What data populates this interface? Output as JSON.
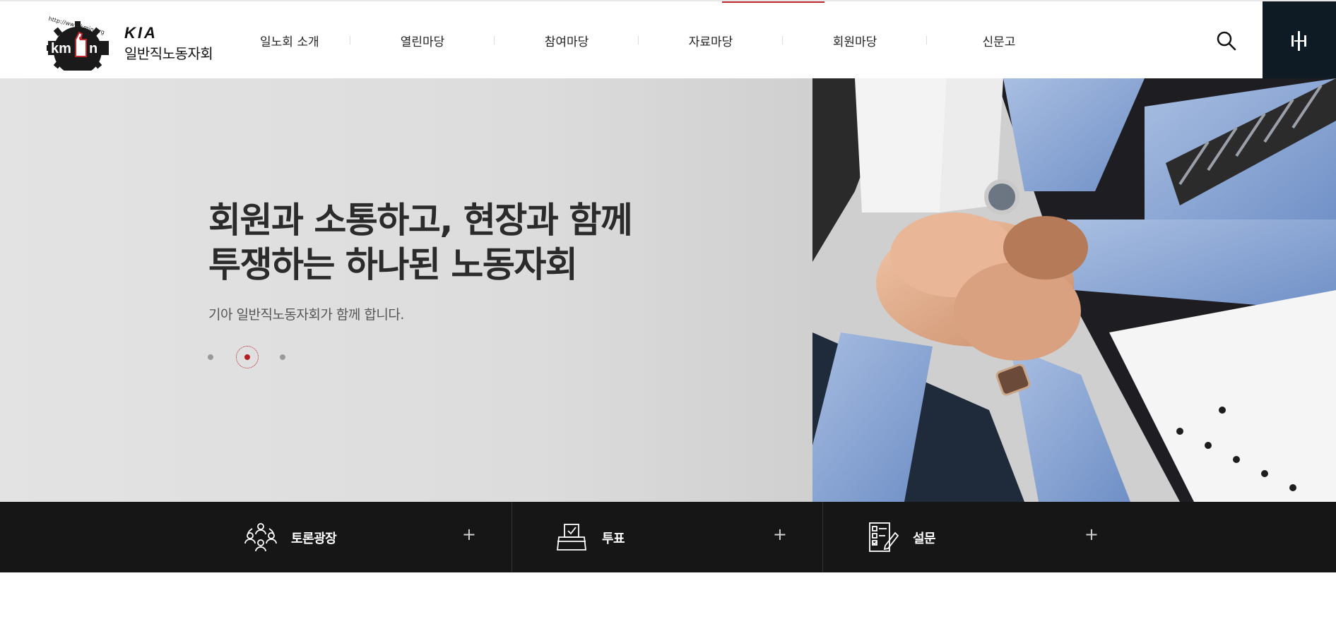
{
  "header": {
    "logo": {
      "url_text": "http://www.kmin.org",
      "mark_text": "kmin",
      "brand_text": "KIA",
      "org_name": "일반직노동자회"
    },
    "nav": [
      {
        "label": "일노회 소개"
      },
      {
        "label": "열린마당"
      },
      {
        "label": "참여마당"
      },
      {
        "label": "자료마당"
      },
      {
        "label": "회원마당"
      },
      {
        "label": "신문고"
      }
    ],
    "search_icon": "search-icon",
    "menu_icon": "menu-bars-icon",
    "accent_color": "#c1272d",
    "menu_bg_color": "#0e1a24"
  },
  "hero": {
    "title_line1": "회원과 소통하고, 현장과 함께",
    "title_line2": "투쟁하는 하나된 노동자회",
    "subtitle": "기아 일반직노동자회가 함께 합니다.",
    "slides_count": 3,
    "active_slide": 2
  },
  "quick_links": [
    {
      "label": "토론광장",
      "icon": "discussion-people-icon",
      "plus": "+"
    },
    {
      "label": "투표",
      "icon": "ballot-box-icon",
      "plus": "+"
    },
    {
      "label": "설문",
      "icon": "survey-checklist-icon",
      "plus": "+"
    }
  ]
}
